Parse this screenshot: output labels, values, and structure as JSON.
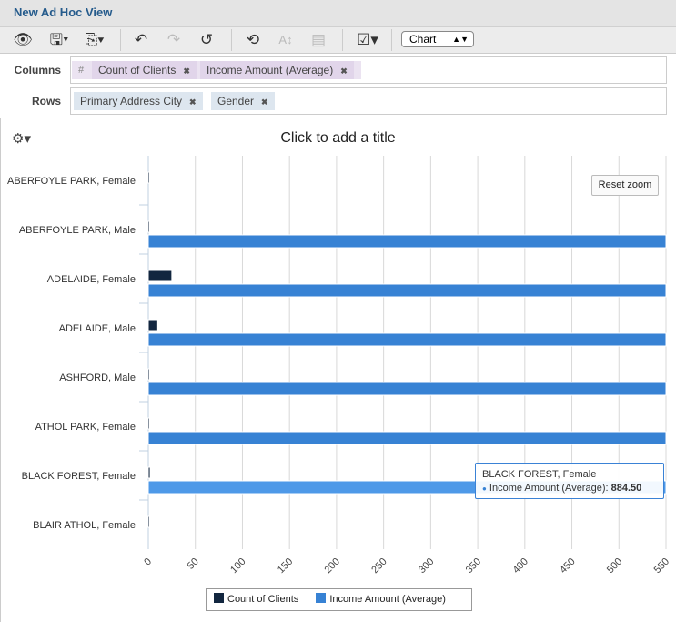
{
  "window": {
    "title": "New Ad Hoc View"
  },
  "toolbar": {
    "icons": [
      "eye-icon",
      "save-icon",
      "export-icon",
      "undo-icon",
      "redo-icon",
      "reset-icon",
      "switch-axes-icon",
      "sort-icon",
      "query-icon",
      "display-options-icon"
    ],
    "view_type": "Chart"
  },
  "columns": {
    "label": "Columns",
    "hash": "#",
    "items": [
      "Count of Clients",
      "Income Amount (Average)"
    ]
  },
  "rows": {
    "label": "Rows",
    "items": [
      "Primary Address City",
      "Gender"
    ]
  },
  "chart": {
    "title_placeholder": "Click to add a title",
    "reset_zoom": "Reset zoom",
    "tooltip": {
      "category": "BLACK FOREST, Female",
      "series": "Income Amount (Average)",
      "value": "884.50"
    }
  },
  "chart_data": {
    "type": "bar",
    "orientation": "horizontal",
    "categories": [
      "ABERFOYLE PARK, Female",
      "ABERFOYLE PARK, Male",
      "ADELAIDE, Female",
      "ADELAIDE, Male",
      "ASHFORD, Male",
      "ATHOL PARK, Female",
      "BLACK FOREST, Female",
      "BLAIR ATHOL, Female"
    ],
    "series": [
      {
        "name": "Count of Clients",
        "color": "#12263f",
        "values": [
          1,
          1,
          25,
          10,
          1,
          1,
          2,
          1
        ]
      },
      {
        "name": "Income Amount (Average)",
        "color": "#3782d4",
        "values": [
          null,
          null,
          null,
          null,
          null,
          null,
          884.5,
          null
        ],
        "exceeds_axis": [
          false,
          true,
          true,
          true,
          true,
          true,
          true,
          false
        ]
      }
    ],
    "xlim": [
      0,
      550
    ],
    "xticks": [
      "0",
      "50",
      "100",
      "150",
      "200",
      "250",
      "300",
      "350",
      "400",
      "450",
      "500",
      "550"
    ],
    "grid": true,
    "legend": "bottom"
  }
}
